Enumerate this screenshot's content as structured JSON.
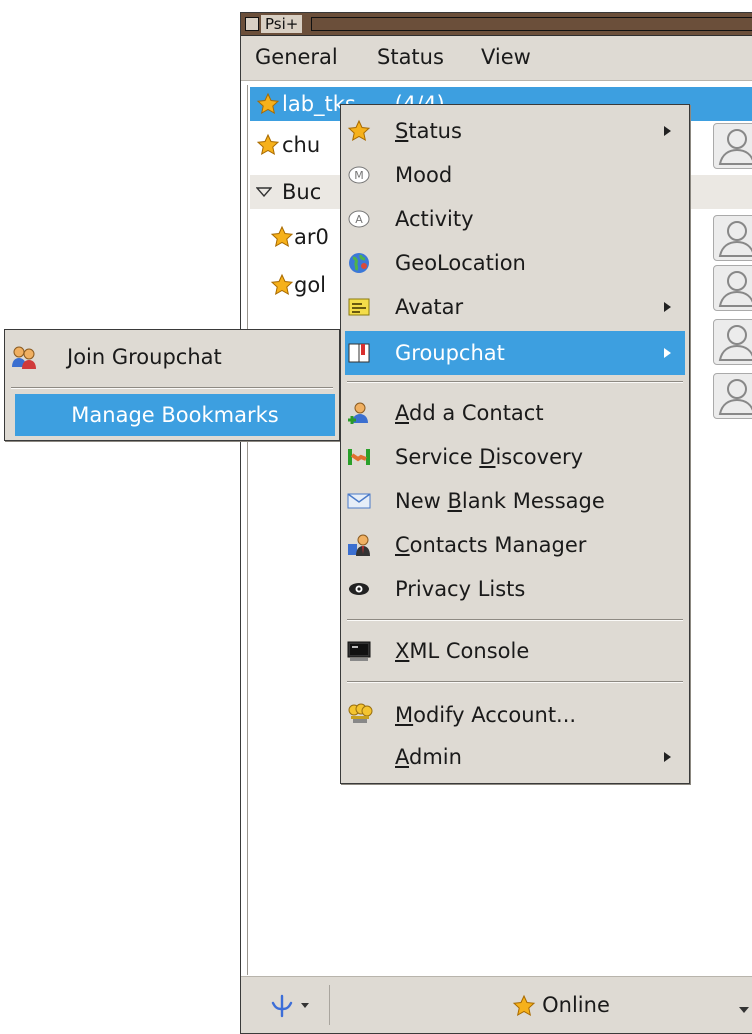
{
  "window": {
    "title": "Psi+"
  },
  "menubar": {
    "items": [
      "General",
      "Status",
      "View"
    ]
  },
  "roster": {
    "account": "lab_tks",
    "account_count": "(4/4)",
    "contact_1": "chu",
    "group": "Buc",
    "contact_2": "ar0",
    "contact_3": "gol"
  },
  "main_menu": {
    "items": [
      {
        "id": "status",
        "label": "Status",
        "underline": "S",
        "rest": "tatus",
        "submenu": true,
        "icon": "star-icon"
      },
      {
        "id": "mood",
        "label": "Mood",
        "submenu": false,
        "icon": "mood-icon"
      },
      {
        "id": "activity",
        "label": "Activity",
        "submenu": false,
        "icon": "activity-icon"
      },
      {
        "id": "geolocation",
        "label": "GeoLocation",
        "submenu": false,
        "icon": "globe-icon"
      },
      {
        "id": "avatar",
        "label": "Avatar",
        "submenu": true,
        "icon": "avatar-card-icon"
      },
      {
        "id": "groupchat",
        "label": "Groupchat",
        "submenu": true,
        "icon": "book-icon",
        "highlighted": true
      },
      {
        "id": "add-contact",
        "label": "Add a Contact",
        "underline": "A",
        "rest": "dd a Contact",
        "submenu": false,
        "icon": "add-user-icon"
      },
      {
        "id": "service-discovery",
        "label": "Service Discovery",
        "pre": "Service ",
        "underline": "D",
        "rest": "iscovery",
        "submenu": false,
        "icon": "handshake-icon"
      },
      {
        "id": "new-message",
        "label": "New Blank Message",
        "pre": "New ",
        "underline": "B",
        "rest": "lank Message",
        "submenu": false,
        "icon": "envelope-icon"
      },
      {
        "id": "contacts-manager",
        "label": "Contacts Manager",
        "underline": "C",
        "rest": "ontacts Manager",
        "submenu": false,
        "icon": "contacts-manager-icon"
      },
      {
        "id": "privacy-lists",
        "label": "Privacy Lists",
        "submenu": false,
        "icon": "eye-icon"
      },
      {
        "id": "xml-console",
        "label": "XML Console",
        "underline": "X",
        "rest": "ML Console",
        "submenu": false,
        "icon": "monitor-icon"
      },
      {
        "id": "modify-account",
        "label": "Modify Account...",
        "underline": "M",
        "rest": "odify Account...",
        "submenu": false,
        "icon": "keys-icon"
      },
      {
        "id": "admin",
        "label": "Admin",
        "underline": "A",
        "rest": "dmin",
        "submenu": true,
        "icon": ""
      }
    ]
  },
  "groupchat_submenu": {
    "join": "Join Groupchat",
    "manage": "Manage Bookmarks"
  },
  "statusbar": {
    "status": "Online"
  },
  "colors": {
    "highlight": "#3d9fe0",
    "menu_bg": "#dedad3",
    "titlebar": "#6b4f3a"
  }
}
